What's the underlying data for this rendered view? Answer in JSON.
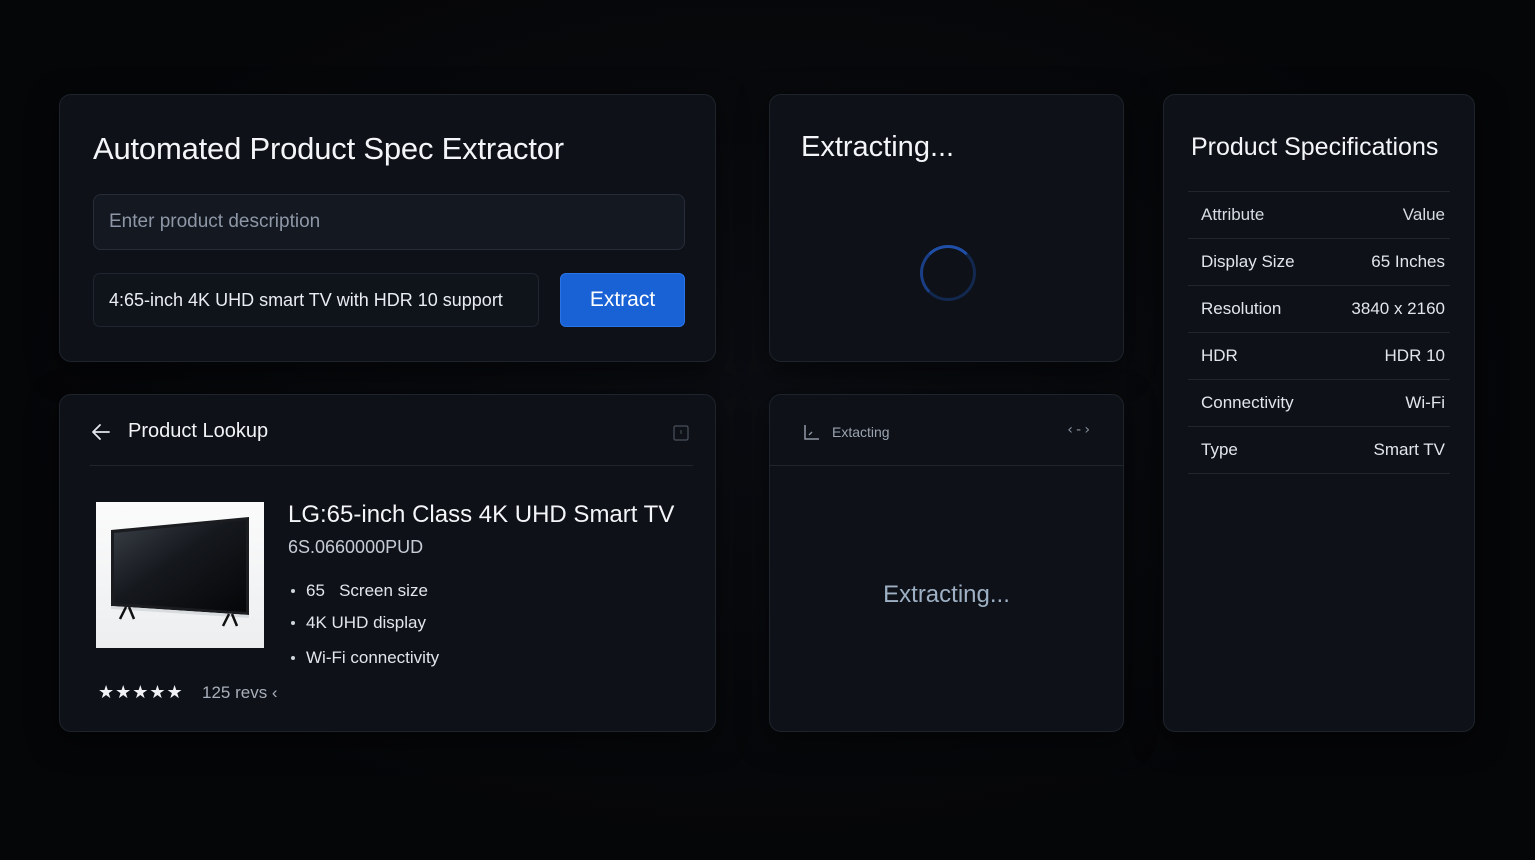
{
  "extractor": {
    "title": "Automated Product Spec Extractor",
    "description_placeholder": "Enter product description",
    "query_value": "4:65-inch 4K UHD smart TV with HDR 10 support",
    "extract_button": "Extract"
  },
  "spinner_panel": {
    "title": "Extracting..."
  },
  "specs": {
    "title": "Product Specifications",
    "header": {
      "attribute": "Attribute",
      "value": "Value"
    },
    "rows": [
      {
        "attribute": "Display Size",
        "value": "65 Inches"
      },
      {
        "attribute": "Resolution",
        "value": "3840 x 2160"
      },
      {
        "attribute": "HDR",
        "value": "HDR 10"
      },
      {
        "attribute": "Connectivity",
        "value": "Wi-Fi"
      },
      {
        "attribute": "Type",
        "value": "Smart TV"
      }
    ]
  },
  "lookup": {
    "title": "Product Lookup",
    "product_name": "LG:65-inch Class 4K UHD Smart TV",
    "sku": "6S.0660000PUD",
    "features": [
      "65   Screen size",
      "4K UHD display",
      "Wi-Fi connectivity"
    ],
    "stars": "★★★★★",
    "reviews": "125 revs ‹"
  },
  "extracting_panel": {
    "header_label": "Extacting",
    "code_icon": "‹-›",
    "status": "Extracting..."
  },
  "icons": {
    "back": "arrow-left-icon",
    "window": "window-icon",
    "chart": "chart-icon",
    "code": "code-icon"
  },
  "colors": {
    "background": "#050608",
    "card": "#0e1117",
    "accent": "#1962d6"
  }
}
